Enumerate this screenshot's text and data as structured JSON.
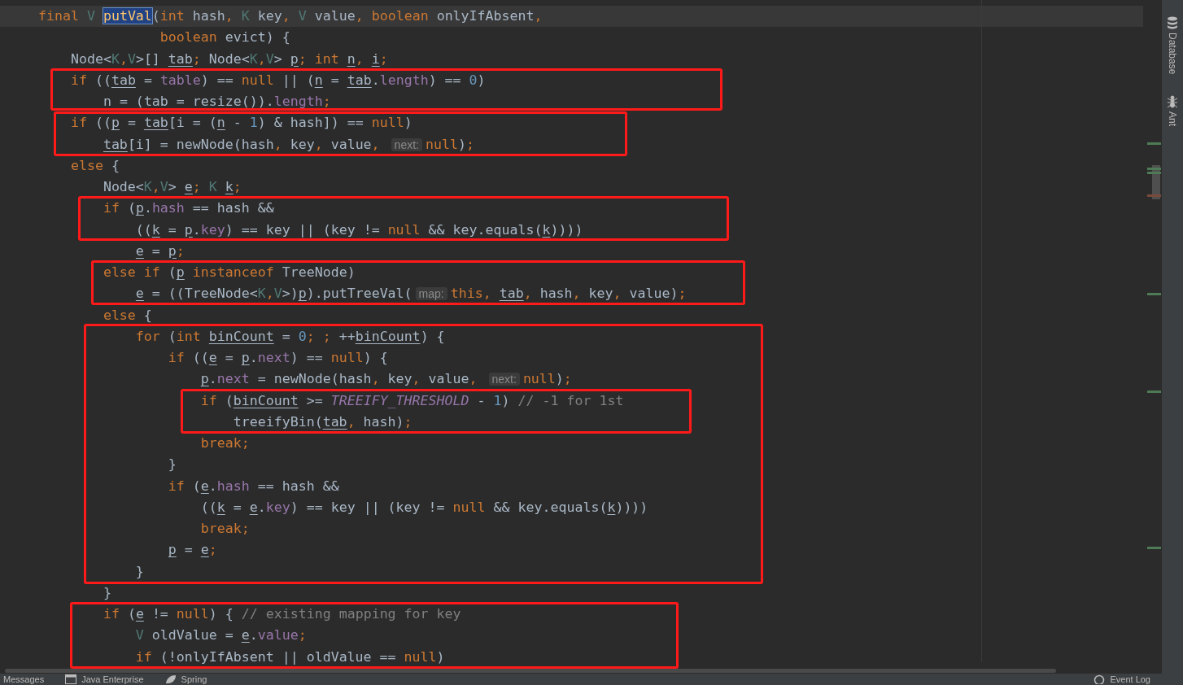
{
  "editor": {
    "lines": [
      {
        "current": true,
        "tokens": [
          {
            "kind": "kw",
            "text": "    final"
          },
          {
            "kind": "tp",
            "text": " V "
          },
          {
            "kind": "decl",
            "text": "putVal"
          },
          {
            "kind": "id",
            "text": "("
          },
          {
            "kind": "kw",
            "text": "int"
          },
          {
            "kind": "id",
            "text": " hash"
          },
          {
            "kind": "kw",
            "text": ", "
          },
          {
            "kind": "tp",
            "text": "K"
          },
          {
            "kind": "id",
            "text": " key"
          },
          {
            "kind": "kw",
            "text": ", "
          },
          {
            "kind": "tp",
            "text": "V"
          },
          {
            "kind": "id",
            "text": " value"
          },
          {
            "kind": "kw",
            "text": ", boolean"
          },
          {
            "kind": "id",
            "text": " onlyIfAbsent"
          },
          {
            "kind": "kw",
            "text": ","
          }
        ]
      },
      {
        "current": false,
        "tokens": [
          {
            "kind": "kw",
            "text": "                   boolean"
          },
          {
            "kind": "id",
            "text": " evict) {"
          }
        ]
      },
      {
        "current": false,
        "tokens": [
          {
            "kind": "id",
            "text": "        Node<"
          },
          {
            "kind": "tp",
            "text": "K"
          },
          {
            "kind": "kw",
            "text": ","
          },
          {
            "kind": "tp",
            "text": "V"
          },
          {
            "kind": "id",
            "text": ">[] "
          },
          {
            "kind": "var",
            "text": "tab"
          },
          {
            "kind": "kw",
            "text": "; "
          },
          {
            "kind": "id",
            "text": "Node<"
          },
          {
            "kind": "tp",
            "text": "K"
          },
          {
            "kind": "kw",
            "text": ","
          },
          {
            "kind": "tp",
            "text": "V"
          },
          {
            "kind": "id",
            "text": "> "
          },
          {
            "kind": "var",
            "text": "p"
          },
          {
            "kind": "kw",
            "text": "; int "
          },
          {
            "kind": "var",
            "text": "n"
          },
          {
            "kind": "kw",
            "text": ", "
          },
          {
            "kind": "var",
            "text": "i"
          },
          {
            "kind": "kw",
            "text": ";"
          }
        ]
      },
      {
        "current": false,
        "tokens": [
          {
            "kind": "kw",
            "text": "        if"
          },
          {
            "kind": "id",
            "text": " (("
          },
          {
            "kind": "var",
            "text": "tab"
          },
          {
            "kind": "id",
            "text": " = "
          },
          {
            "kind": "fld",
            "text": "table"
          },
          {
            "kind": "id",
            "text": ") == "
          },
          {
            "kind": "kw",
            "text": "null"
          },
          {
            "kind": "id",
            "text": " || ("
          },
          {
            "kind": "var",
            "text": "n"
          },
          {
            "kind": "id",
            "text": " = "
          },
          {
            "kind": "var",
            "text": "tab"
          },
          {
            "kind": "id",
            "text": "."
          },
          {
            "kind": "fld",
            "text": "length"
          },
          {
            "kind": "id",
            "text": ") == "
          },
          {
            "kind": "num",
            "text": "0"
          },
          {
            "kind": "id",
            "text": ")"
          }
        ]
      },
      {
        "current": false,
        "tokens": [
          {
            "kind": "var",
            "text": "            n"
          },
          {
            "kind": "id",
            "text": " = ("
          },
          {
            "kind": "var",
            "text": "tab"
          },
          {
            "kind": "id",
            "text": " = resize())."
          },
          {
            "kind": "fld",
            "text": "length"
          },
          {
            "kind": "kw",
            "text": ";"
          }
        ]
      },
      {
        "current": false,
        "tokens": [
          {
            "kind": "kw",
            "text": "        if"
          },
          {
            "kind": "id",
            "text": " (("
          },
          {
            "kind": "var",
            "text": "p"
          },
          {
            "kind": "id",
            "text": " = "
          },
          {
            "kind": "var",
            "text": "tab"
          },
          {
            "kind": "id",
            "text": "[i = ("
          },
          {
            "kind": "var",
            "text": "n"
          },
          {
            "kind": "id",
            "text": " - "
          },
          {
            "kind": "num",
            "text": "1"
          },
          {
            "kind": "id",
            "text": ") & hash]) == "
          },
          {
            "kind": "kw",
            "text": "null"
          },
          {
            "kind": "id",
            "text": ")"
          }
        ]
      },
      {
        "current": false,
        "tokens": [
          {
            "kind": "var",
            "text": "            tab"
          },
          {
            "kind": "id",
            "text": "[i] = newNode(hash"
          },
          {
            "kind": "kw",
            "text": ", "
          },
          {
            "kind": "id",
            "text": "key"
          },
          {
            "kind": "kw",
            "text": ", "
          },
          {
            "kind": "id",
            "text": "value"
          },
          {
            "kind": "kw",
            "text": ", "
          },
          {
            "kind": "hint",
            "text": "next:"
          },
          {
            "kind": "kw",
            "text": "null"
          },
          {
            "kind": "id",
            "text": ")"
          },
          {
            "kind": "kw",
            "text": ";"
          }
        ]
      },
      {
        "current": false,
        "tokens": [
          {
            "kind": "kw",
            "text": "        else"
          },
          {
            "kind": "id",
            "text": " {"
          }
        ]
      },
      {
        "current": false,
        "tokens": [
          {
            "kind": "id",
            "text": "            Node<"
          },
          {
            "kind": "tp",
            "text": "K"
          },
          {
            "kind": "kw",
            "text": ","
          },
          {
            "kind": "tp",
            "text": "V"
          },
          {
            "kind": "id",
            "text": "> "
          },
          {
            "kind": "var",
            "text": "e"
          },
          {
            "kind": "kw",
            "text": "; "
          },
          {
            "kind": "tp",
            "text": "K "
          },
          {
            "kind": "var",
            "text": "k"
          },
          {
            "kind": "kw",
            "text": ";"
          }
        ]
      },
      {
        "current": false,
        "tokens": [
          {
            "kind": "kw",
            "text": "            if"
          },
          {
            "kind": "id",
            "text": " ("
          },
          {
            "kind": "var",
            "text": "p"
          },
          {
            "kind": "id",
            "text": "."
          },
          {
            "kind": "fld",
            "text": "hash"
          },
          {
            "kind": "id",
            "text": " == hash &&"
          }
        ]
      },
      {
        "current": false,
        "tokens": [
          {
            "kind": "id",
            "text": "                (("
          },
          {
            "kind": "var",
            "text": "k"
          },
          {
            "kind": "id",
            "text": " = "
          },
          {
            "kind": "var",
            "text": "p"
          },
          {
            "kind": "id",
            "text": "."
          },
          {
            "kind": "fld",
            "text": "key"
          },
          {
            "kind": "id",
            "text": ") == key || (key != "
          },
          {
            "kind": "kw",
            "text": "null"
          },
          {
            "kind": "id",
            "text": " && key.equals("
          },
          {
            "kind": "var",
            "text": "k"
          },
          {
            "kind": "id",
            "text": "))))"
          }
        ]
      },
      {
        "current": false,
        "tokens": [
          {
            "kind": "var",
            "text": "                e"
          },
          {
            "kind": "id",
            "text": " = "
          },
          {
            "kind": "var",
            "text": "p"
          },
          {
            "kind": "kw",
            "text": ";"
          }
        ]
      },
      {
        "current": false,
        "tokens": [
          {
            "kind": "kw",
            "text": "            else if"
          },
          {
            "kind": "id",
            "text": " ("
          },
          {
            "kind": "var",
            "text": "p"
          },
          {
            "kind": "kw",
            "text": " instanceof"
          },
          {
            "kind": "id",
            "text": " TreeNode)"
          }
        ]
      },
      {
        "current": false,
        "tokens": [
          {
            "kind": "var",
            "text": "                e"
          },
          {
            "kind": "id",
            "text": " = ((TreeNode<"
          },
          {
            "kind": "tp",
            "text": "K"
          },
          {
            "kind": "kw",
            "text": ","
          },
          {
            "kind": "tp",
            "text": "V"
          },
          {
            "kind": "id",
            "text": ">)"
          },
          {
            "kind": "var",
            "text": "p"
          },
          {
            "kind": "id",
            "text": ").putTreeVal("
          },
          {
            "kind": "hint",
            "text": "map:"
          },
          {
            "kind": "kw",
            "text": "this, "
          },
          {
            "kind": "var",
            "text": "tab"
          },
          {
            "kind": "kw",
            "text": ", "
          },
          {
            "kind": "id",
            "text": "hash"
          },
          {
            "kind": "kw",
            "text": ", "
          },
          {
            "kind": "id",
            "text": "key"
          },
          {
            "kind": "kw",
            "text": ", "
          },
          {
            "kind": "id",
            "text": "value)"
          },
          {
            "kind": "kw",
            "text": ";"
          }
        ]
      },
      {
        "current": false,
        "tokens": [
          {
            "kind": "kw",
            "text": "            else"
          },
          {
            "kind": "id",
            "text": " {"
          }
        ]
      },
      {
        "current": false,
        "tokens": [
          {
            "kind": "kw",
            "text": "                for"
          },
          {
            "kind": "id",
            "text": " ("
          },
          {
            "kind": "kw",
            "text": "int "
          },
          {
            "kind": "var",
            "text": "binCount"
          },
          {
            "kind": "id",
            "text": " = "
          },
          {
            "kind": "num",
            "text": "0"
          },
          {
            "kind": "kw",
            "text": "; ; "
          },
          {
            "kind": "id",
            "text": "++"
          },
          {
            "kind": "var",
            "text": "binCount"
          },
          {
            "kind": "id",
            "text": ") {"
          }
        ]
      },
      {
        "current": false,
        "tokens": [
          {
            "kind": "kw",
            "text": "                    if"
          },
          {
            "kind": "id",
            "text": " (("
          },
          {
            "kind": "var",
            "text": "e"
          },
          {
            "kind": "id",
            "text": " = "
          },
          {
            "kind": "var",
            "text": "p"
          },
          {
            "kind": "id",
            "text": "."
          },
          {
            "kind": "fld",
            "text": "next"
          },
          {
            "kind": "id",
            "text": ") == "
          },
          {
            "kind": "kw",
            "text": "null"
          },
          {
            "kind": "id",
            "text": ") {"
          }
        ]
      },
      {
        "current": false,
        "tokens": [
          {
            "kind": "var",
            "text": "                        p"
          },
          {
            "kind": "id",
            "text": "."
          },
          {
            "kind": "fld",
            "text": "next"
          },
          {
            "kind": "id",
            "text": " = newNode(hash"
          },
          {
            "kind": "kw",
            "text": ", "
          },
          {
            "kind": "id",
            "text": "key"
          },
          {
            "kind": "kw",
            "text": ", "
          },
          {
            "kind": "id",
            "text": "value"
          },
          {
            "kind": "kw",
            "text": ", "
          },
          {
            "kind": "hint",
            "text": "next:"
          },
          {
            "kind": "kw",
            "text": "null"
          },
          {
            "kind": "id",
            "text": ")"
          },
          {
            "kind": "kw",
            "text": ";"
          }
        ]
      },
      {
        "current": false,
        "tokens": [
          {
            "kind": "kw",
            "text": "                        if"
          },
          {
            "kind": "id",
            "text": " ("
          },
          {
            "kind": "var",
            "text": "binCount"
          },
          {
            "kind": "id",
            "text": " >= "
          },
          {
            "kind": "const",
            "text": "TREEIFY_THRESHOLD"
          },
          {
            "kind": "id",
            "text": " - "
          },
          {
            "kind": "num",
            "text": "1"
          },
          {
            "kind": "id",
            "text": ") "
          },
          {
            "kind": "cmt",
            "text": "// -1 for 1st"
          }
        ]
      },
      {
        "current": false,
        "tokens": [
          {
            "kind": "id",
            "text": "                            treeifyBin("
          },
          {
            "kind": "var",
            "text": "tab"
          },
          {
            "kind": "kw",
            "text": ", "
          },
          {
            "kind": "id",
            "text": "hash)"
          },
          {
            "kind": "kw",
            "text": ";"
          }
        ]
      },
      {
        "current": false,
        "tokens": [
          {
            "kind": "kw",
            "text": "                        break;"
          }
        ]
      },
      {
        "current": false,
        "tokens": [
          {
            "kind": "id",
            "text": "                    }"
          }
        ]
      },
      {
        "current": false,
        "tokens": [
          {
            "kind": "kw",
            "text": "                    if"
          },
          {
            "kind": "id",
            "text": " ("
          },
          {
            "kind": "var",
            "text": "e"
          },
          {
            "kind": "id",
            "text": "."
          },
          {
            "kind": "fld",
            "text": "hash"
          },
          {
            "kind": "id",
            "text": " == hash &&"
          }
        ]
      },
      {
        "current": false,
        "tokens": [
          {
            "kind": "id",
            "text": "                        (("
          },
          {
            "kind": "var",
            "text": "k"
          },
          {
            "kind": "id",
            "text": " = "
          },
          {
            "kind": "var",
            "text": "e"
          },
          {
            "kind": "id",
            "text": "."
          },
          {
            "kind": "fld",
            "text": "key"
          },
          {
            "kind": "id",
            "text": ") == key || (key != "
          },
          {
            "kind": "kw",
            "text": "null"
          },
          {
            "kind": "id",
            "text": " && key.equals("
          },
          {
            "kind": "var",
            "text": "k"
          },
          {
            "kind": "id",
            "text": "))))"
          }
        ]
      },
      {
        "current": false,
        "tokens": [
          {
            "kind": "kw",
            "text": "                        break;"
          }
        ]
      },
      {
        "current": false,
        "tokens": [
          {
            "kind": "var",
            "text": "                    p"
          },
          {
            "kind": "id",
            "text": " = "
          },
          {
            "kind": "var",
            "text": "e"
          },
          {
            "kind": "kw",
            "text": ";"
          }
        ]
      },
      {
        "current": false,
        "tokens": [
          {
            "kind": "id",
            "text": "                }"
          }
        ]
      },
      {
        "current": false,
        "tokens": [
          {
            "kind": "id",
            "text": "            }"
          }
        ]
      },
      {
        "current": false,
        "tokens": [
          {
            "kind": "kw",
            "text": "            if"
          },
          {
            "kind": "id",
            "text": " ("
          },
          {
            "kind": "var",
            "text": "e"
          },
          {
            "kind": "id",
            "text": " != "
          },
          {
            "kind": "kw",
            "text": "null"
          },
          {
            "kind": "id",
            "text": ") { "
          },
          {
            "kind": "cmt",
            "text": "// existing mapping for key"
          }
        ]
      },
      {
        "current": false,
        "tokens": [
          {
            "kind": "tp",
            "text": "                V"
          },
          {
            "kind": "id",
            "text": " oldValue = "
          },
          {
            "kind": "var",
            "text": "e"
          },
          {
            "kind": "id",
            "text": "."
          },
          {
            "kind": "fld",
            "text": "value"
          },
          {
            "kind": "kw",
            "text": ";"
          }
        ]
      },
      {
        "current": false,
        "tokens": [
          {
            "kind": "kw",
            "text": "                if"
          },
          {
            "kind": "id",
            "text": " (!onlyIfAbsent || oldValue == "
          },
          {
            "kind": "kw",
            "text": "null"
          },
          {
            "kind": "id",
            "text": ")"
          }
        ]
      }
    ]
  },
  "right_tool_strip": [
    {
      "kind": "database",
      "label": "Database"
    },
    {
      "kind": "ant",
      "label": "Ant"
    }
  ],
  "bottom_tool_bar": [
    {
      "kind": "plain",
      "label": "Messages"
    },
    {
      "kind": "enterprise",
      "label": "Java Enterprise"
    },
    {
      "kind": "spring",
      "label": "Spring"
    }
  ],
  "bottom_tool_bar_right": [
    {
      "kind": "log",
      "label": "Event Log"
    }
  ]
}
